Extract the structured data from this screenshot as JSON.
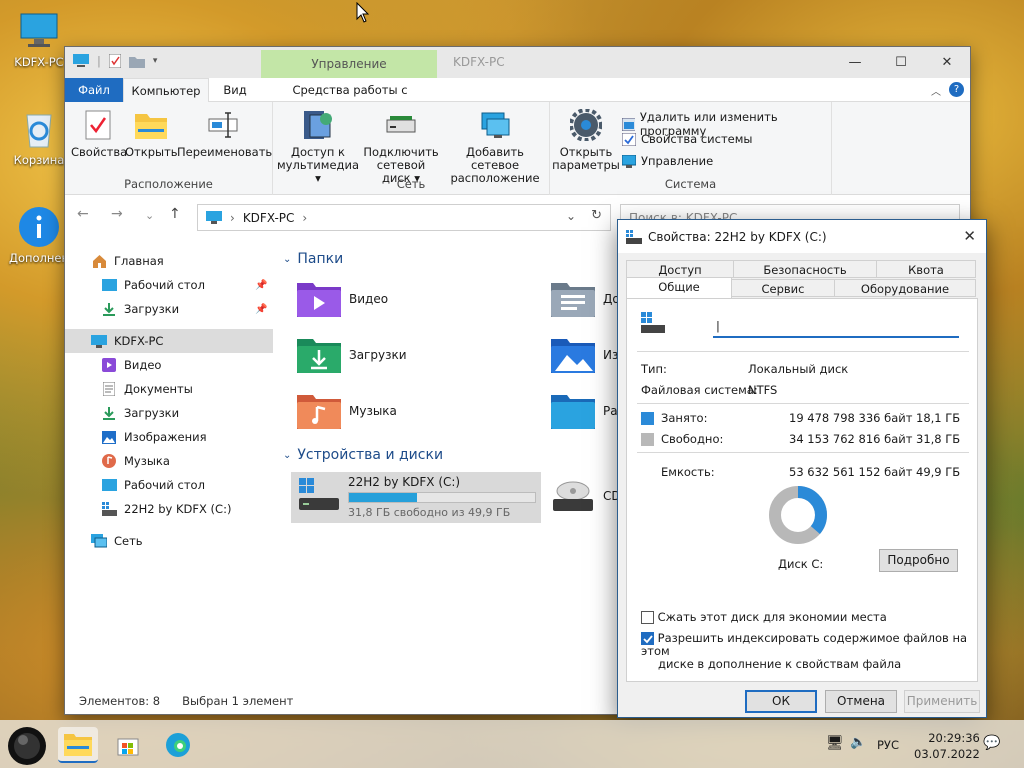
{
  "desktop": {
    "icons": [
      {
        "label": "KDFX-PC",
        "icon": "computer-icon"
      },
      {
        "label": "Корзина",
        "icon": "recycle-bin-icon"
      },
      {
        "label": "Дополнен",
        "icon": "info-icon"
      }
    ]
  },
  "explorer": {
    "title": "KDFX-PC",
    "context_tab": "Управление",
    "menu_tabs": [
      "Файл",
      "Компьютер",
      "Вид",
      "Средства работы с дисками"
    ],
    "ribbon": {
      "location_group": {
        "label": "Расположение",
        "buttons": [
          "Свойства",
          "Открыть",
          "Переименовать"
        ]
      },
      "network_group": {
        "label": "Сеть",
        "buttons": [
          {
            "line1": "Доступ к",
            "line2": "мультимедиа ▾"
          },
          {
            "line1": "Подключить",
            "line2": "сетевой диск ▾"
          },
          {
            "line1": "Добавить сетевое",
            "line2": "расположение"
          }
        ]
      },
      "system_group": {
        "label": "Система",
        "open_params": {
          "line1": "Открыть",
          "line2": "параметры"
        },
        "small_buttons": [
          "Удалить или изменить программу",
          "Свойства системы",
          "Управление"
        ]
      }
    },
    "address": {
      "path": "KDFX-PC",
      "search_placeholder": "Поиск в: KDFX-PC"
    },
    "nav": {
      "quick": "Главная",
      "quick_items": [
        "Рабочий стол",
        "Загрузки"
      ],
      "pc": "KDFX-PC",
      "pc_items": [
        "Видео",
        "Документы",
        "Загрузки",
        "Изображения",
        "Музыка",
        "Рабочий стол",
        "22H2 by KDFX (C:)"
      ],
      "network": "Сеть"
    },
    "folders_header": "Папки",
    "folders": [
      "Видео",
      "Загрузки",
      "Музыка",
      "До",
      "Изо",
      "Раб"
    ],
    "devices_header": "Устройства и диски",
    "drive": {
      "name": "22H2 by KDFX (C:)",
      "free_text": "31,8 ГБ свободно из 49,9 ГБ",
      "used_fraction": 0.363
    },
    "cd_label": "CD",
    "status": {
      "items": "Элементов: 8",
      "selected": "Выбран 1 элемент"
    }
  },
  "props": {
    "title": "Свойства: 22H2 by KDFX (C:)",
    "tabs_top": [
      "Доступ",
      "Безопасность",
      "Квота"
    ],
    "tabs_bottom": [
      "Общие",
      "Сервис",
      "Оборудование"
    ],
    "type_label": "Тип:",
    "type_value": "Локальный диск",
    "fs_label": "Файловая система:",
    "fs_value": "NTFS",
    "used_label": "Занято:",
    "used_bytes": "19 478 798 336 байт",
    "used_gb": "18,1 ГБ",
    "free_label": "Свободно:",
    "free_bytes": "34 153 762 816 байт",
    "free_gb": "31,8 ГБ",
    "cap_label": "Емкость:",
    "cap_bytes": "53 632 561 152 байт",
    "cap_gb": "49,9 ГБ",
    "disk_label": "Диск C:",
    "details_btn": "Подробно",
    "compress_label": "Сжать этот диск для экономии места",
    "index_label_1": "Разрешить индексировать содержимое файлов на этом",
    "index_label_2": "диске в дополнение к свойствам файла",
    "ok": "ОК",
    "cancel": "Отмена",
    "apply": "Применить",
    "used_color": "#2b8ad8",
    "free_color": "#b8b8b8",
    "used_fraction": 0.363
  },
  "taskbar": {
    "lang": "РУС",
    "time": "20:29:36",
    "date": "03.07.2022"
  }
}
